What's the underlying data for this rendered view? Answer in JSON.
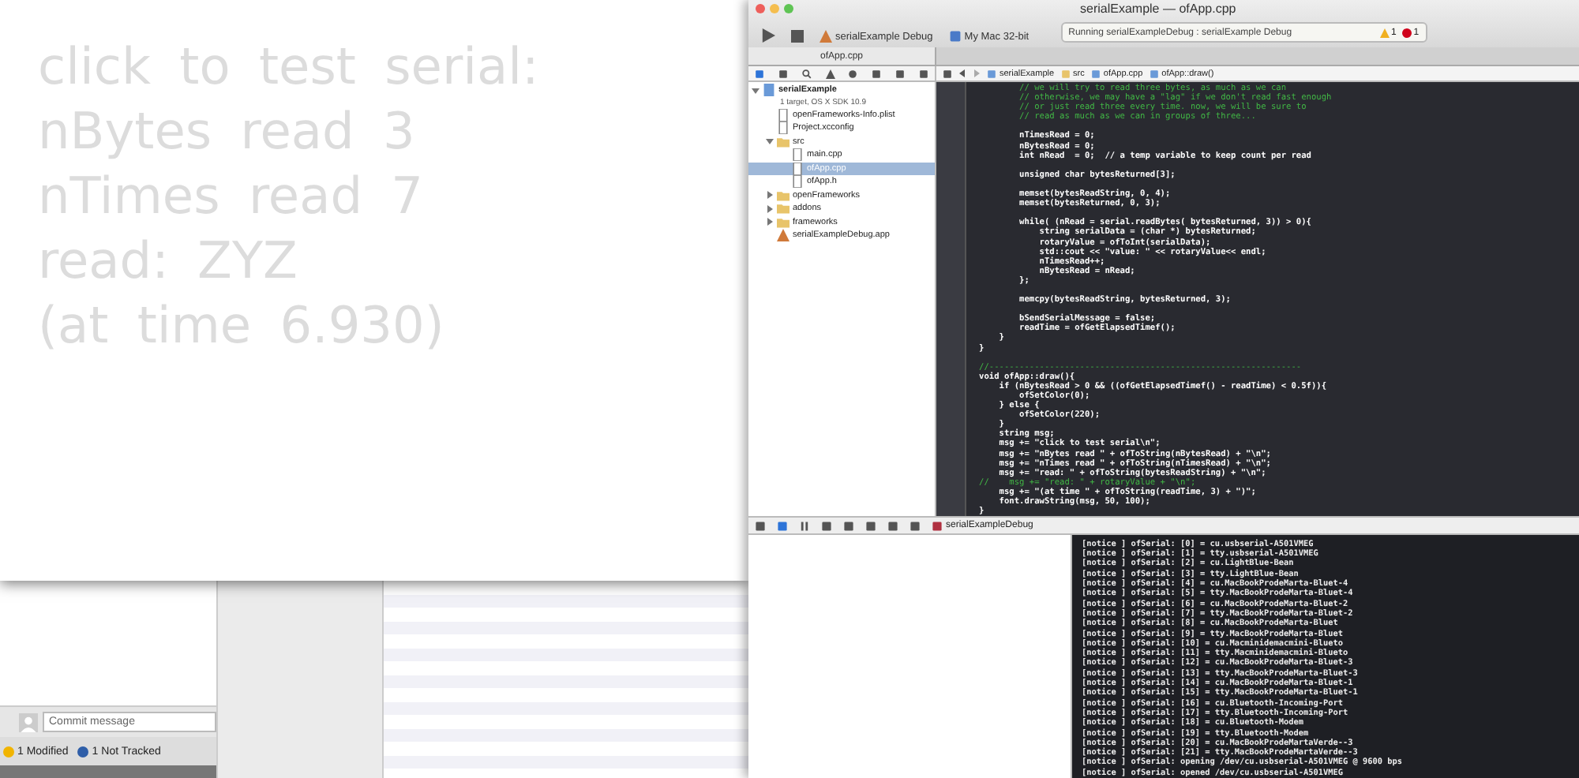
{
  "app_window": {
    "lines": [
      "click to test serial:",
      "nBytes read 3",
      "nTimes read 7",
      "read: ZYZ",
      "(at time 6.930)"
    ]
  },
  "git_panel": {
    "commit": {
      "placeholder": "Commit message"
    },
    "status": [
      {
        "kind": "modified",
        "label": "1 Modified"
      },
      {
        "kind": "untracked",
        "label": "1 Not Tracked"
      }
    ]
  },
  "xcode": {
    "title": "serialExample — ofApp.cpp",
    "toolbar": {
      "scheme": "serialExample Debug",
      "destination": "My Mac 32-bit",
      "activity": "Running serialExampleDebug : serialExample Debug",
      "warnings": "1",
      "errors": "1"
    },
    "tab": {
      "label": "ofApp.cpp",
      "selected": true
    },
    "breadcrumbs": [
      "serialExample",
      "src",
      "ofApp.cpp",
      "ofApp::draw()"
    ],
    "navigator": [
      {
        "label": "serialExample",
        "subtitle": "1 target, OS X SDK 10.9",
        "kind": "project",
        "expanded": true,
        "selected": false,
        "children": [
          {
            "label": "openFrameworks-Info.plist",
            "kind": "file",
            "selected": false
          },
          {
            "label": "Project.xcconfig",
            "kind": "file",
            "selected": false
          },
          {
            "label": "src",
            "kind": "folder",
            "expanded": true,
            "selected": false,
            "children": [
              {
                "label": "main.cpp",
                "kind": "file",
                "selected": false
              },
              {
                "label": "ofApp.cpp",
                "kind": "file",
                "selected": true
              },
              {
                "label": "ofApp.h",
                "kind": "file",
                "selected": false
              }
            ]
          },
          {
            "label": "openFrameworks",
            "kind": "folder",
            "expanded": false,
            "selected": false
          },
          {
            "label": "addons",
            "kind": "folder",
            "expanded": false,
            "selected": false
          },
          {
            "label": "frameworks",
            "kind": "folder",
            "expanded": false,
            "selected": false
          },
          {
            "label": "serialExampleDebug.app",
            "kind": "app",
            "selected": false
          }
        ]
      }
    ],
    "code": [
      {
        "kind": "comment",
        "text": "        // we will try to read three bytes, as much as we can"
      },
      {
        "kind": "comment",
        "text": "        // otherwise, we may have a \"lag\" if we don't read fast enough"
      },
      {
        "kind": "comment",
        "text": "        // or just read three every time. now, we will be sure to"
      },
      {
        "kind": "comment",
        "text": "        // read as much as we can in groups of three..."
      },
      {
        "kind": "blank"
      },
      {
        "kind": "code",
        "text": "        nTimesRead = 0;"
      },
      {
        "kind": "code",
        "text": "        nBytesRead = 0;"
      },
      {
        "kind": "code",
        "text": "        int nRead  = 0;  // a temp variable to keep count per read"
      },
      {
        "kind": "blank"
      },
      {
        "kind": "code",
        "text": "        unsigned char bytesReturned[3];"
      },
      {
        "kind": "blank"
      },
      {
        "kind": "code",
        "text": "        memset(bytesReadString, 0, 4);"
      },
      {
        "kind": "code",
        "text": "        memset(bytesReturned, 0, 3);"
      },
      {
        "kind": "blank"
      },
      {
        "kind": "code",
        "text": "        while( (nRead = serial.readBytes( bytesReturned, 3)) > 0){"
      },
      {
        "kind": "code",
        "text": "            string serialData = (char *) bytesReturned;"
      },
      {
        "kind": "code",
        "text": "            rotaryValue = ofToInt(serialData);"
      },
      {
        "kind": "code",
        "text": "            std::cout << \"value: \" << rotaryValue<< endl;"
      },
      {
        "kind": "code",
        "text": "            nTimesRead++;"
      },
      {
        "kind": "code",
        "text": "            nBytesRead = nRead;"
      },
      {
        "kind": "code",
        "text": "        };"
      },
      {
        "kind": "blank"
      },
      {
        "kind": "code",
        "text": "        memcpy(bytesReadString, bytesReturned, 3);"
      },
      {
        "kind": "blank"
      },
      {
        "kind": "code",
        "text": "        bSendSerialMessage = false;"
      },
      {
        "kind": "code",
        "text": "        readTime = ofGetElapsedTimef();"
      },
      {
        "kind": "code",
        "text": "    }"
      },
      {
        "kind": "code",
        "text": "}"
      },
      {
        "kind": "blank"
      },
      {
        "kind": "comment",
        "text": "//--------------------------------------------------------------"
      },
      {
        "kind": "code",
        "text": "void ofApp::draw(){"
      },
      {
        "kind": "code",
        "text": "    if (nBytesRead > 0 && ((ofGetElapsedTimef() - readTime) < 0.5f)){"
      },
      {
        "kind": "code",
        "text": "        ofSetColor(0);"
      },
      {
        "kind": "code",
        "text": "    } else {"
      },
      {
        "kind": "code",
        "text": "        ofSetColor(220);"
      },
      {
        "kind": "code",
        "text": "    }"
      },
      {
        "kind": "code",
        "text": "    string msg;"
      },
      {
        "kind": "code",
        "text": "    msg += \"click to test serial\\n\";"
      },
      {
        "kind": "code",
        "text": "    msg += \"nBytes read \" + ofToString(nBytesRead) + \"\\n\";"
      },
      {
        "kind": "code",
        "text": "    msg += \"nTimes read \" + ofToString(nTimesRead) + \"\\n\";"
      },
      {
        "kind": "code",
        "text": "    msg += \"read: \" + ofToString(bytesReadString) + \"\\n\";"
      },
      {
        "kind": "comment",
        "text": "//    msg += \"read: \" + rotaryValue + \"\\n\";"
      },
      {
        "kind": "code",
        "text": "    msg += \"(at time \" + ofToString(readTime, 3) + \")\";"
      },
      {
        "kind": "code",
        "text": "    font.drawString(msg, 50, 100);"
      },
      {
        "kind": "code",
        "text": "}"
      }
    ],
    "debug_bar": {
      "process": "serialExampleDebug"
    },
    "console": [
      "[notice ] ofSerial: [0] = cu.usbserial-A501VMEG",
      "[notice ] ofSerial: [1] = tty.usbserial-A501VMEG",
      "[notice ] ofSerial: [2] = cu.LightBlue-Bean",
      "[notice ] ofSerial: [3] = tty.LightBlue-Bean",
      "[notice ] ofSerial: [4] = cu.MacBookProdeMarta-Bluet-4",
      "[notice ] ofSerial: [5] = tty.MacBookProdeMarta-Bluet-4",
      "[notice ] ofSerial: [6] = cu.MacBookProdeMarta-Bluet-2",
      "[notice ] ofSerial: [7] = tty.MacBookProdeMarta-Bluet-2",
      "[notice ] ofSerial: [8] = cu.MacBookProdeMarta-Bluet",
      "[notice ] ofSerial: [9] = tty.MacBookProdeMarta-Bluet",
      "[notice ] ofSerial: [10] = cu.Macminidemacmini-Blueto",
      "[notice ] ofSerial: [11] = tty.Macminidemacmini-Blueto",
      "[notice ] ofSerial: [12] = cu.MacBookProdeMarta-Bluet-3",
      "[notice ] ofSerial: [13] = tty.MacBookProdeMarta-Bluet-3",
      "[notice ] ofSerial: [14] = cu.MacBookProdeMarta-Bluet-1",
      "[notice ] ofSerial: [15] = tty.MacBookProdeMarta-Bluet-1",
      "[notice ] ofSerial: [16] = cu.Bluetooth-Incoming-Port",
      "[notice ] ofSerial: [17] = tty.Bluetooth-Incoming-Port",
      "[notice ] ofSerial: [18] = cu.Bluetooth-Modem",
      "[notice ] ofSerial: [19] = tty.Bluetooth-Modem",
      "[notice ] ofSerial: [20] = cu.MacBookProdeMartaVerde--3",
      "[notice ] ofSerial: [21] = tty.MacBookProdeMartaVerde--3",
      "[notice ] ofSerial: opening /dev/cu.usbserial-A501VMEG @ 9600 bps",
      "[notice ] ofSerial: opened /dev/cu.usbserial-A501VMEG"
    ]
  }
}
